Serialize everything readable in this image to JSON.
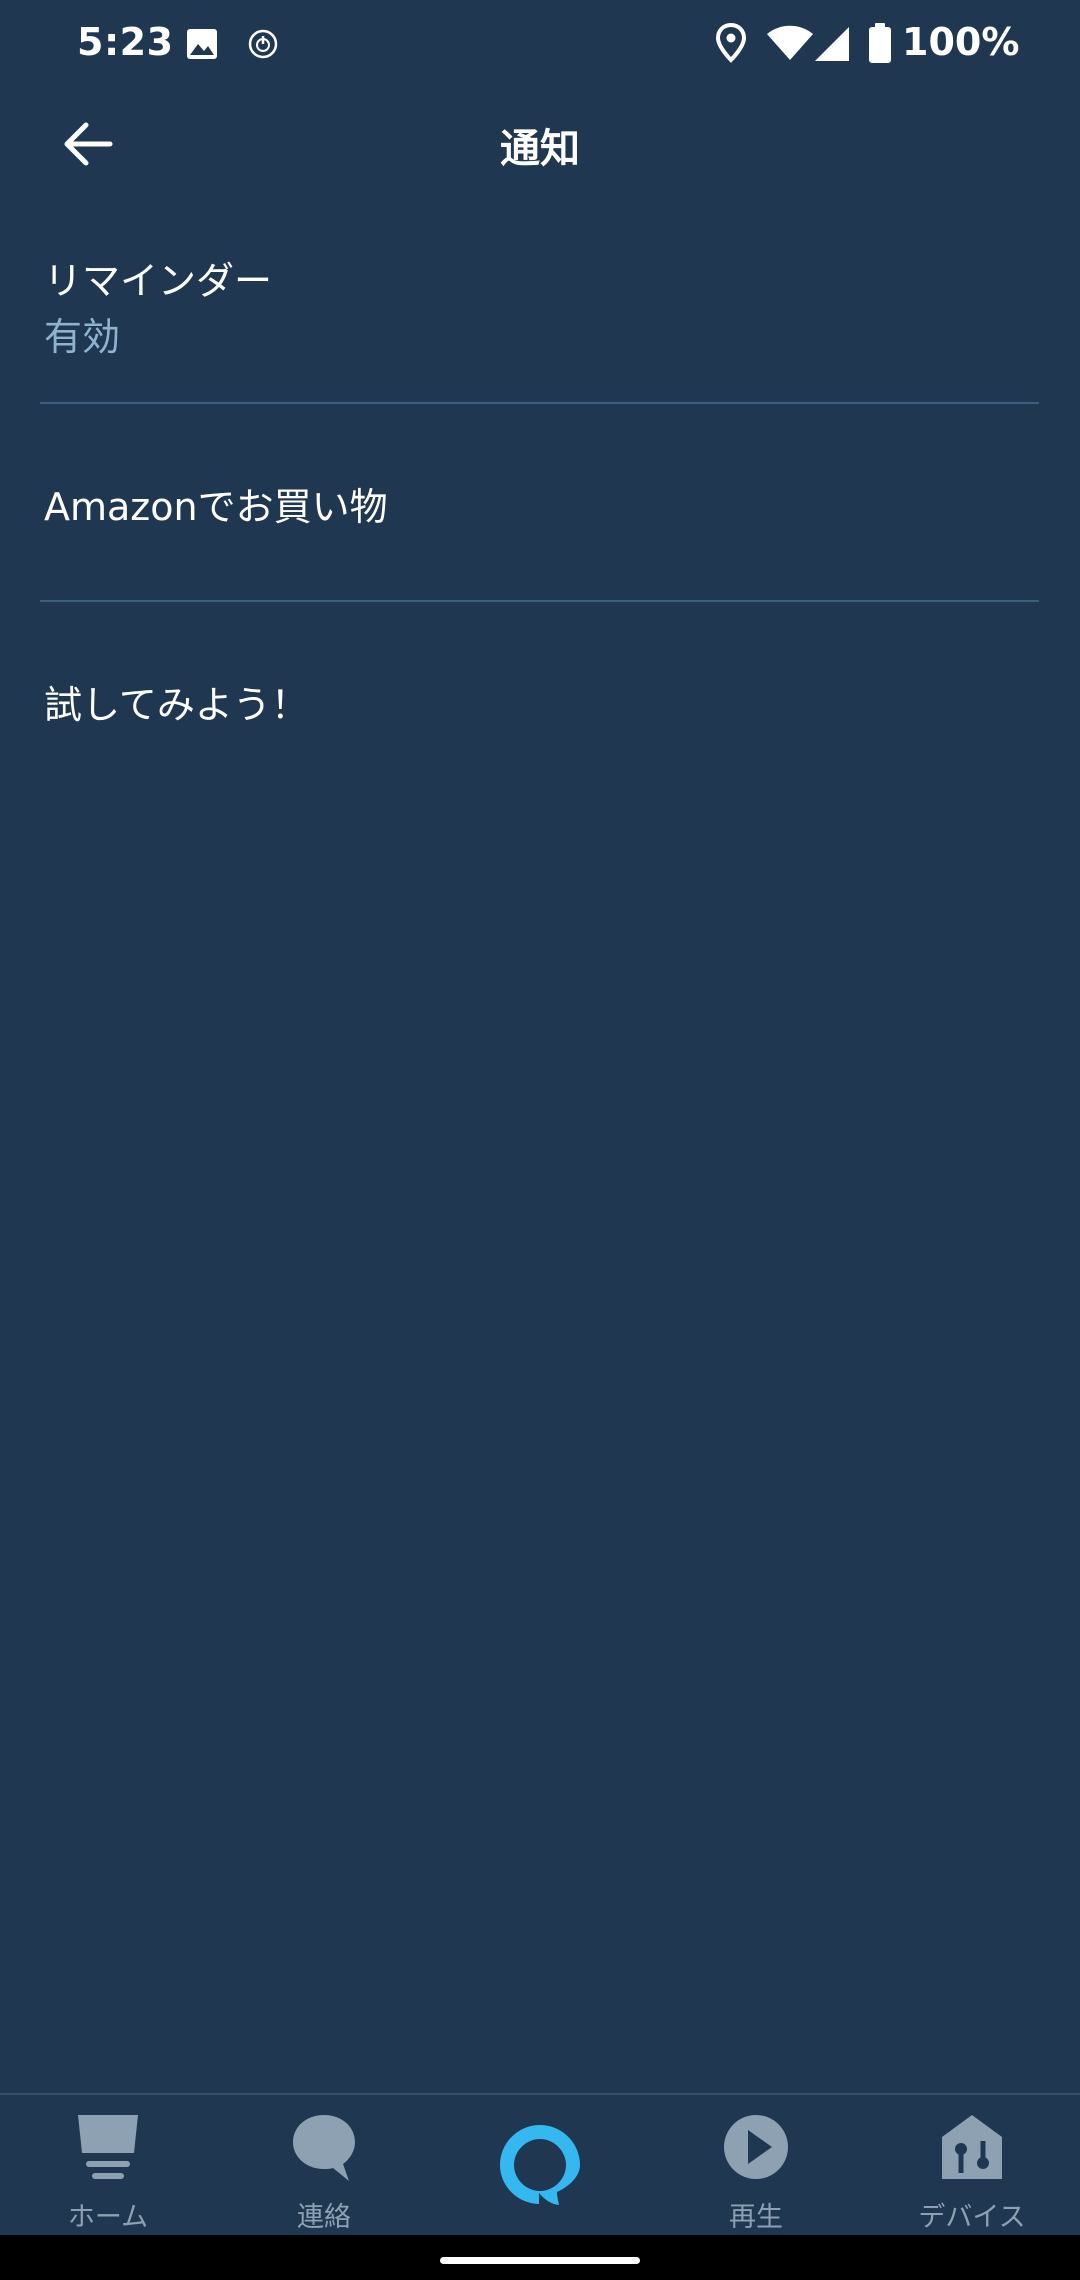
{
  "status_bar": {
    "time": "5:23",
    "icons": [
      "image-icon",
      "power-icon",
      "location-icon",
      "wifi-icon",
      "signal-icon",
      "battery-icon"
    ],
    "battery_text": "100%"
  },
  "header": {
    "title": "通知",
    "back_icon": "arrow-left-icon"
  },
  "list": {
    "items": [
      {
        "title": "リマインダー",
        "subtitle": "有効"
      },
      {
        "title": "Amazonでお買い物"
      },
      {
        "title": "試してみよう！"
      }
    ]
  },
  "bottom_nav": {
    "items": [
      {
        "label": "ホーム",
        "icon": "home-icon"
      },
      {
        "label": "連絡",
        "icon": "chat-bubble-icon"
      },
      {
        "label": "",
        "icon": "alexa-ring-icon"
      },
      {
        "label": "再生",
        "icon": "play-icon"
      },
      {
        "label": "デバイス",
        "icon": "devices-icon"
      }
    ]
  },
  "colors": {
    "background": "#1f3750",
    "divider": "#3d5e7c",
    "subtitle": "#8fb2cf",
    "nav_icon": "#8ea1b3",
    "alexa_accent": "#35b8f0"
  }
}
